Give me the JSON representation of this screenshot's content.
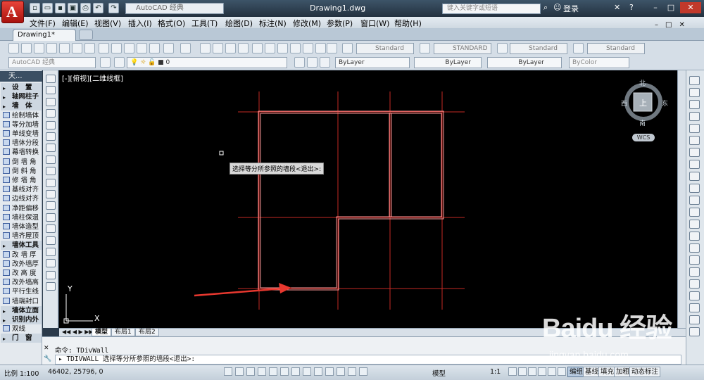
{
  "titlebar": {
    "workspace": "AutoCAD 经典",
    "title": "Drawing1.dwg",
    "search_placeholder": "键入关键字或短语",
    "login": "登录"
  },
  "menu": [
    "文件(F)",
    "编辑(E)",
    "视图(V)",
    "插入(I)",
    "格式(O)",
    "工具(T)",
    "绘图(D)",
    "标注(N)",
    "修改(M)",
    "参数(P)",
    "窗口(W)",
    "帮助(H)"
  ],
  "doc_tab": "Drawing1*",
  "styles": {
    "text_style": "Standard",
    "dim_style": "STANDARD",
    "table_style": "Standard",
    "mleader_style": "Standard"
  },
  "layers": {
    "workspace": "AutoCAD 经典",
    "current_layer": "0",
    "color": "ByLayer",
    "linetype": "ByLayer",
    "lineweight": "ByLayer",
    "plotstyle": "ByColor"
  },
  "palette": {
    "title": "天...",
    "items": [
      {
        "label": "设　置",
        "type": "section"
      },
      {
        "label": "轴网柱子",
        "type": "section"
      },
      {
        "label": "墙　体",
        "type": "section"
      },
      {
        "label": "绘制墙体",
        "type": "tool"
      },
      {
        "label": "等分加墙",
        "type": "tool"
      },
      {
        "label": "单线变墙",
        "type": "tool"
      },
      {
        "label": "墙体分段",
        "type": "tool"
      },
      {
        "label": "幕墙转换",
        "type": "tool"
      },
      {
        "label": "倒 墙 角",
        "type": "tool"
      },
      {
        "label": "倒 斜 角",
        "type": "tool"
      },
      {
        "label": "修 墙 角",
        "type": "tool"
      },
      {
        "label": "基线对齐",
        "type": "tool"
      },
      {
        "label": "边线对齐",
        "type": "tool"
      },
      {
        "label": "净距偏移",
        "type": "tool"
      },
      {
        "label": "墙柱保温",
        "type": "tool"
      },
      {
        "label": "墙体造型",
        "type": "tool"
      },
      {
        "label": "墙齐屋顶",
        "type": "tool"
      },
      {
        "label": "墙体工具",
        "type": "section"
      },
      {
        "label": "改 墙 厚",
        "type": "tool"
      },
      {
        "label": "改外墙厚",
        "type": "tool"
      },
      {
        "label": "改 高 度",
        "type": "tool"
      },
      {
        "label": "改外墙高",
        "type": "tool"
      },
      {
        "label": "平行生线",
        "type": "tool"
      },
      {
        "label": "墙端封口",
        "type": "tool"
      },
      {
        "label": "墙体立面",
        "type": "section"
      },
      {
        "label": "识别内外",
        "type": "section"
      },
      {
        "label": "双线",
        "type": "extra"
      },
      {
        "label": "门　窗",
        "type": "section"
      }
    ]
  },
  "viewport_label": "[-][俯视][二维线框]",
  "viewcube": {
    "north": "北",
    "south": "南",
    "east": "东",
    "west": "西",
    "top": "上",
    "wcs": "WCS"
  },
  "canvas_prompt": "选择等分所参照的墙段<退出>:",
  "layout_tabs": [
    "模型",
    "布局1",
    "布局2"
  ],
  "command": {
    "history": "命令: TDivWall",
    "current": "TDIVWALL 选择等分所参照的墙段<退出>:"
  },
  "statusbar": {
    "scale": "比例 1:100",
    "coords": "46402, 25796, 0",
    "model": "模型",
    "annoscale": "1:1",
    "buttons": [
      "编组",
      "基线",
      "填充",
      "加粗",
      "动态标注"
    ]
  },
  "watermark": {
    "brand": "Baidu 经验",
    "url": "jingyan.baidu.com"
  },
  "colors": {
    "wall": "#ff8f8f",
    "axis": "#e0302a",
    "arrow": "#e8382f",
    "canvas": "#000000"
  }
}
